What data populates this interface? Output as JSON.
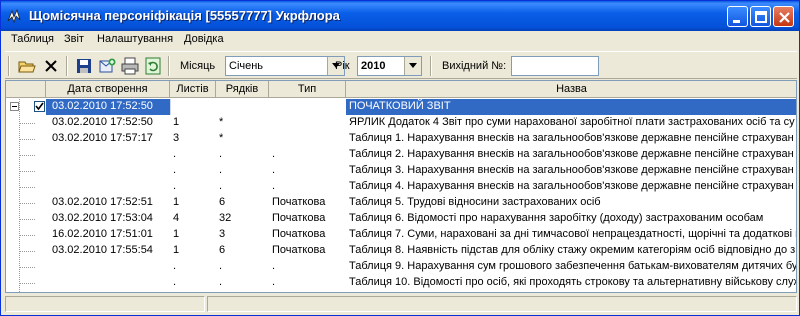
{
  "window": {
    "title": "Щомісячна персоніфікація [55557777] Укрфлора"
  },
  "menu": [
    "Таблиця",
    "Звіт",
    "Налаштування",
    "Довідка"
  ],
  "toolbar": {
    "tools": [
      "folder-open-icon",
      "delete-x-icon",
      "save-icon",
      "add-report-icon",
      "print-icon",
      "refresh-icon"
    ],
    "month_label": "Місяць",
    "month_value": "Січень",
    "year_label": "Рік",
    "year_value": "2010",
    "outgoing_label": "Вихідний №:",
    "outgoing_value": ""
  },
  "grid": {
    "columns": [
      "Дата створення",
      "Листів",
      "Рядків",
      "Тип",
      "Назва"
    ],
    "rows": [
      {
        "date": "03.02.2010 17:52:50",
        "sheets": "",
        "lines": "",
        "type": "",
        "name": "ПОЧАТКОВИЙ ЗВІТ",
        "selected": true,
        "root": true
      },
      {
        "date": "03.02.2010 17:52:50",
        "sheets": "1",
        "lines": "*",
        "type": "",
        "name": "ЯРЛИК Додаток 4 Звіт про суми нарахованої заробітної плати застрахованих осіб та су"
      },
      {
        "date": "03.02.2010 17:57:17",
        "sheets": "3",
        "lines": "*",
        "type": "",
        "name": "Таблиця 1. Нарахування внесків на загальнообов'язкове державне пенсійне страхуван"
      },
      {
        "date": "",
        "sheets": ".",
        "lines": ".",
        "type": ".",
        "name": "Таблиця 2. Нарахування внесків на загальнообов'язкове державне пенсійне страхуван"
      },
      {
        "date": "",
        "sheets": ".",
        "lines": ".",
        "type": ".",
        "name": "Таблиця 3. Нарахування внесків на загальнообов'язкове державне пенсійне страхуван"
      },
      {
        "date": "",
        "sheets": ".",
        "lines": ".",
        "type": ".",
        "name": "Таблиця 4. Нарахування внесків на загальнообов'язкове державне пенсійне страхуван"
      },
      {
        "date": "03.02.2010 17:52:51",
        "sheets": "1",
        "lines": "6",
        "type": "Початкова",
        "name": "Таблиця 5. Трудові відносини застрахованих осіб"
      },
      {
        "date": "03.02.2010 17:53:04",
        "sheets": "4",
        "lines": "32",
        "type": "Початкова",
        "name": "Таблиця 6. Відомості про нарахування заробітку (доходу) застрахованим особам"
      },
      {
        "date": "16.02.2010 17:51:01",
        "sheets": "1",
        "lines": "3",
        "type": "Початкова",
        "name": "Таблиця 7. Суми, нараховані за дні тимчасової непрацездатності, щорічні та додаткові в"
      },
      {
        "date": "03.02.2010 17:55:54",
        "sheets": "1",
        "lines": "6",
        "type": "Початкова",
        "name": "Таблиця 8. Наявність підстав для обліку стажу окремим категоріям осіб відповідно до з"
      },
      {
        "date": "",
        "sheets": ".",
        "lines": ".",
        "type": ".",
        "name": "Таблиця 9. Нарахування сум грошового забезпечення батькам-вихователям дитячих бу"
      },
      {
        "date": "",
        "sheets": ".",
        "lines": ".",
        "type": ".",
        "name": "Таблиця 10. Відомості про осіб, які проходять строкову та альтернативну військову служ"
      }
    ]
  },
  "colors": {
    "selection": "#316ac5",
    "titlebar": "#0a5be0"
  }
}
